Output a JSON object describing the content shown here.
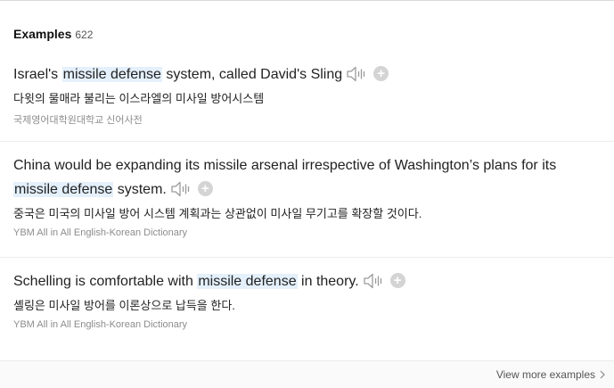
{
  "header": {
    "title": "Examples",
    "count": "622"
  },
  "examples": [
    {
      "pre": "Israel's ",
      "highlight": "missile defense",
      "post": " system, called David's Sling",
      "translation": "다윗의 물매라 불리는 이스라엘의 미사일 방어시스템",
      "source": "국제영어대학원대학교 신어사전"
    },
    {
      "pre": "China would be expanding its missile arsenal irrespective of Washington’s plans for its ",
      "highlight": "missile defense",
      "post": " system.",
      "translation": "중국은 미국의 미사일 방어 시스템 계획과는 상관없이 미사일 무기고를 확장할 것이다.",
      "source": "YBM All in All English-Korean Dictionary"
    },
    {
      "pre": "Schelling is comfortable with ",
      "highlight": "missile defense",
      "post": " in theory.",
      "translation": "셸링은 미사일 방어를 이론상으로 납득을 한다.",
      "source": "YBM All in All English-Korean Dictionary"
    }
  ],
  "footer": {
    "view_more_label": "View more examples"
  },
  "icons": {
    "speaker": "speaker-icon",
    "add": "plus-circle-icon",
    "chevron": "chevron-right-icon"
  },
  "colors": {
    "highlight": "#e4f0fb",
    "source_text": "#8c8c8c",
    "icon": "#9a9a9a"
  }
}
